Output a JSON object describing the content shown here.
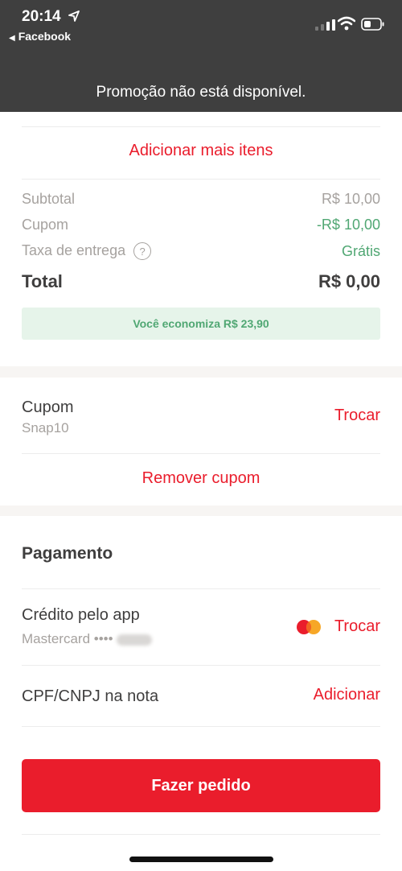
{
  "status_bar": {
    "time": "20:14",
    "back_label": "Facebook",
    "icons": [
      "location-arrow-icon",
      "cellular-signal-icon",
      "wifi-icon",
      "battery-icon"
    ]
  },
  "toast": {
    "message": "Promoção não está disponível."
  },
  "order": {
    "add_more_label": "Adicionar mais itens",
    "summary": {
      "subtotal_label": "Subtotal",
      "subtotal_value": "R$ 10,00",
      "coupon_label": "Cupom",
      "coupon_value": "-R$ 10,00",
      "delivery_label": "Taxa de entrega",
      "delivery_help_glyph": "?",
      "delivery_value": "Grátis",
      "total_label": "Total",
      "total_value": "R$ 0,00"
    },
    "savings_text": "Você economiza R$ 23,90"
  },
  "coupon": {
    "title": "Cupom",
    "code": "Snap10",
    "change_label": "Trocar",
    "remove_label": "Remover cupom"
  },
  "payment": {
    "title": "Pagamento",
    "method": "Crédito pelo app",
    "brand": "Mastercard ••••",
    "brand_icon": "mastercard-icon",
    "change_label": "Trocar",
    "cpf_label": "CPF/CNPJ na nota",
    "cpf_action": "Adicionar"
  },
  "cta": {
    "label": "Fazer pedido"
  },
  "colors": {
    "accent_red": "#ea1d2c",
    "success_green": "#50a773",
    "savings_bg": "#e6f4ea",
    "header_dark": "#3f3f3f",
    "muted_text": "#a6a29f"
  }
}
